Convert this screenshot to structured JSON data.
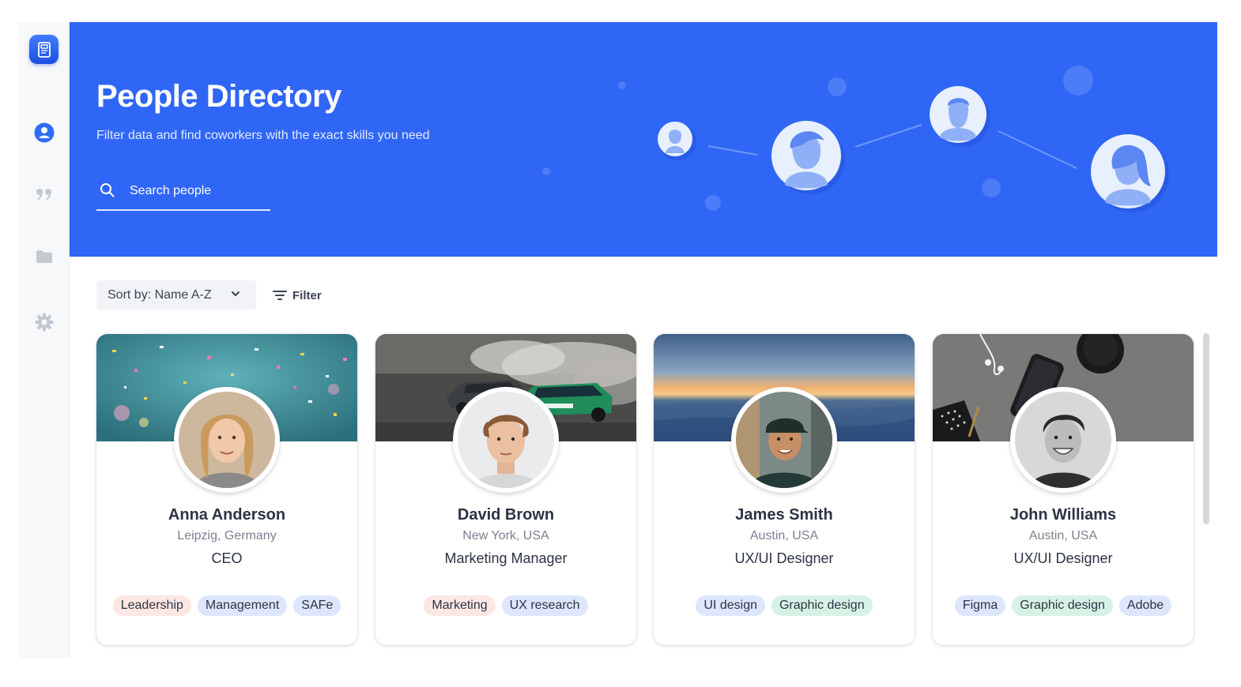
{
  "hero": {
    "title": "People Directory",
    "subtitle": "Filter data and find coworkers with the exact skills you need"
  },
  "search": {
    "placeholder": "Search people"
  },
  "sidebar": {
    "items": [
      {
        "icon": "user-circle-icon",
        "active": true
      },
      {
        "icon": "quote-icon",
        "active": false
      },
      {
        "icon": "folder-icon",
        "active": false
      },
      {
        "icon": "gear-icon",
        "active": false
      }
    ]
  },
  "toolbar": {
    "sort_label": "Sort by: Name A-Z",
    "filter_label": "Filter"
  },
  "cards": [
    {
      "name": "Anna Anderson",
      "location": "Leipzig, Germany",
      "role": "CEO",
      "tags": [
        "Leadership",
        "Management",
        "SAFe"
      ]
    },
    {
      "name": "David Brown",
      "location": "New York, USA",
      "role": "Marketing Manager",
      "tags": [
        "Marketing",
        "UX research"
      ]
    },
    {
      "name": "James Smith",
      "location": "Austin, USA",
      "role": "UX/UI Designer",
      "tags": [
        "UI design",
        "Graphic design"
      ]
    },
    {
      "name": "John Williams",
      "location": "Austin, USA",
      "role": "UX/UI Designer",
      "tags": [
        "Figma",
        "Graphic design",
        "Adobe"
      ]
    }
  ],
  "colors": {
    "accent": "#3066f5",
    "tag_pink": "#fde7e3",
    "tag_blue": "#dde6fb",
    "tag_green": "#d6f2e4"
  }
}
